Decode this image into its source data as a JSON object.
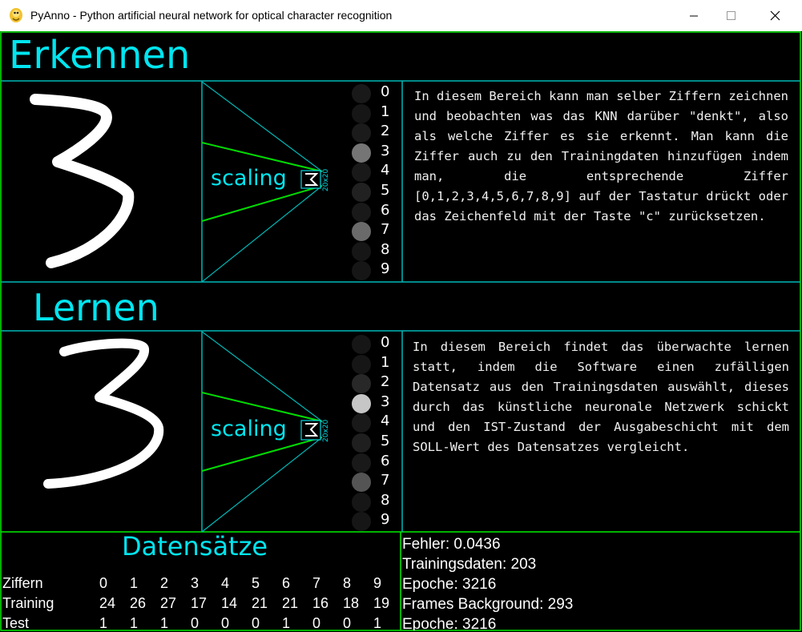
{
  "window": {
    "title": "PyAnno - Python artificial neural network for optical character recognition",
    "icon": "python-snake-icon"
  },
  "erkennen": {
    "heading": "Erkennen",
    "scaling_label": "scaling",
    "size_label": "20x20",
    "output_digits": [
      "0",
      "1",
      "2",
      "3",
      "4",
      "5",
      "6",
      "7",
      "8",
      "9"
    ],
    "activation_brightness": [
      0.03,
      0.02,
      0.04,
      0.45,
      0.03,
      0.07,
      0.03,
      0.4,
      0.02,
      0.02
    ],
    "description": "In diesem Bereich kann man selber Ziffern zeichnen und beobachten was das KNN darüber \"denkt\", also als welche Ziffer es sie erkennt. Man kann die Ziffer auch zu den Trainingdaten hinzufügen indem man, die entsprechende Ziffer [0,1,2,3,4,5,6,7,8,9] auf der Tastatur drückt oder das Zeichenfeld mit der Taste \"c\" zurücksetzen."
  },
  "lernen": {
    "heading": "Lernen",
    "scaling_label": "scaling",
    "size_label": "20x20",
    "output_digits": [
      "0",
      "1",
      "2",
      "3",
      "4",
      "5",
      "6",
      "7",
      "8",
      "9"
    ],
    "activation_brightness": [
      0.02,
      0.02,
      0.1,
      0.82,
      0.03,
      0.06,
      0.03,
      0.3,
      0.02,
      0.02
    ],
    "description": "In diesem Bereich findet das überwachte lernen statt, indem die Software einen zufälligen Datensatz aus den Trainingsdaten auswählt, dieses durch das künstliche neuronale Netzwerk schickt und den IST-Zustand der Ausgabeschicht mit dem SOLL-Wert des Datensatzes vergleicht."
  },
  "datensaetze": {
    "heading": "Datensätze",
    "rows": [
      {
        "label": "Ziffern",
        "values": [
          "0",
          "1",
          "2",
          "3",
          "4",
          "5",
          "6",
          "7",
          "8",
          "9"
        ]
      },
      {
        "label": "Training",
        "values": [
          "24",
          "26",
          "27",
          "17",
          "14",
          "21",
          "21",
          "16",
          "18",
          "19"
        ]
      },
      {
        "label": "Test",
        "values": [
          "1",
          "1",
          "1",
          "0",
          "0",
          "0",
          "1",
          "0",
          "0",
          "1"
        ]
      }
    ]
  },
  "stats": {
    "fehler": "Fehler: 0.0436",
    "trainingsdaten": "Trainingsdaten: 203",
    "epoche": "Epoche: 3216",
    "frames": "Frames Background: 293",
    "epoche2": "Epoche: 3216"
  },
  "colors": {
    "cyan": "#00e5f0",
    "green": "#00ff00",
    "teal_border": "#00b8b8",
    "background": "#000000"
  }
}
